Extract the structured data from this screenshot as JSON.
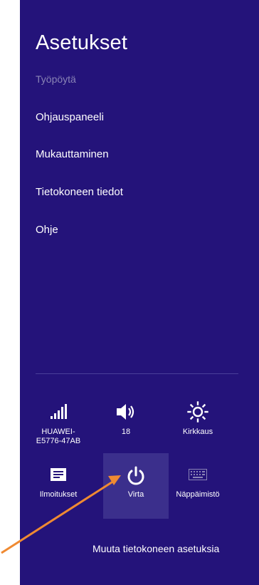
{
  "panel": {
    "title": "Asetukset",
    "subtitle": "Työpöytä",
    "menu": [
      {
        "label": "Ohjauspaneeli"
      },
      {
        "label": "Mukauttaminen"
      },
      {
        "label": "Tietokoneen tiedot"
      },
      {
        "label": "Ohje"
      }
    ],
    "quick_settings": {
      "network": {
        "label": "HUAWEI-\nE5776-47AB",
        "icon": "signal-bars-icon"
      },
      "volume": {
        "label": "18",
        "icon": "speaker-icon"
      },
      "brightness": {
        "label": "Kirkkaus",
        "icon": "sun-icon"
      },
      "notifications": {
        "label": "Ilmoitukset",
        "icon": "message-icon"
      },
      "power": {
        "label": "Virta",
        "icon": "power-icon"
      },
      "keyboard": {
        "label": "Näppäimistö",
        "icon": "keyboard-icon"
      }
    },
    "footer_link": "Muuta tietokoneen asetuksia"
  },
  "colors": {
    "panel_bg": "#24137a",
    "highlight_bg": "#3b2f8c",
    "subtitle": "#8a84b6",
    "annotation_arrow": "#ef8a32"
  }
}
